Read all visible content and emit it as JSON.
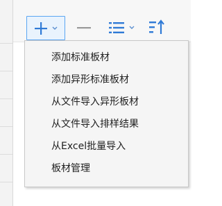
{
  "toolbar": {
    "add_button_icon": "plus-icon",
    "remove_button_icon": "minus-icon",
    "list_button_icon": "list-icon",
    "sort_button_icon": "sort-icon",
    "dropdown_indicator": "chevron-down-icon"
  },
  "menu": {
    "items": [
      {
        "label": "添加标准板材"
      },
      {
        "label": "添加异形标准板材"
      },
      {
        "label": "从文件导入异形板材"
      },
      {
        "label": "从文件导入排样结果"
      },
      {
        "label": "从Excel批量导入"
      },
      {
        "label": "板材管理"
      }
    ]
  },
  "colors": {
    "accent": "#2f7ad6",
    "button_highlight_border": "#5aa6f2",
    "button_highlight_bg": "#e9f3fd",
    "menu_bg": "#f5f5f5",
    "menu_text": "#1f1f1f"
  }
}
